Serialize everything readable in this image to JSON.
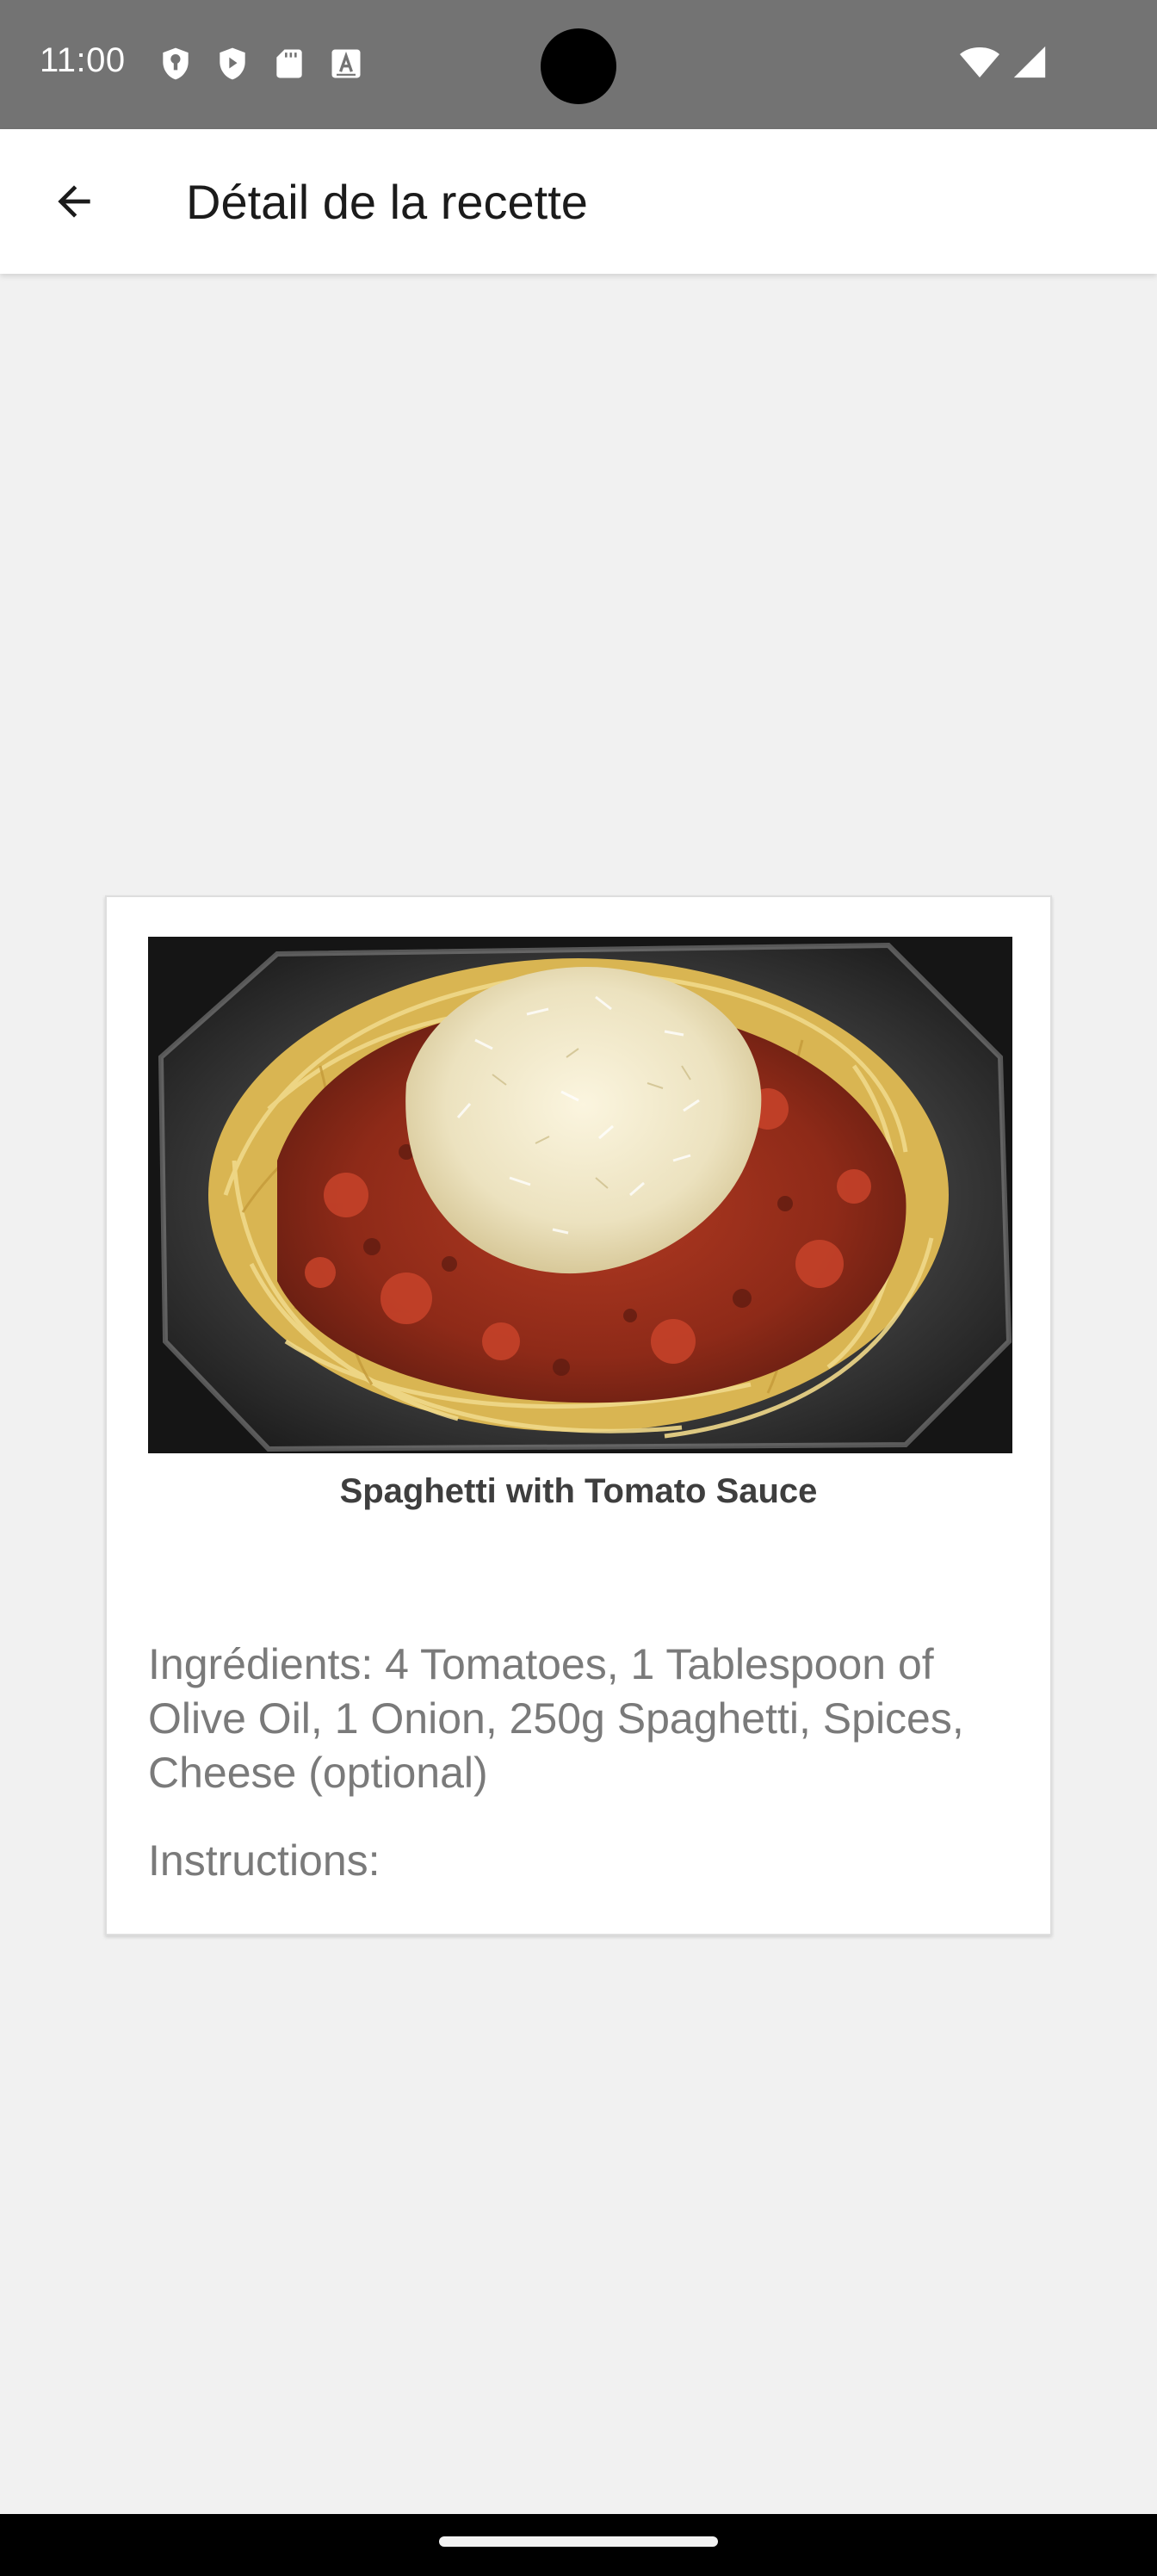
{
  "status_bar": {
    "time": "11:00",
    "left_icons": [
      "vpn-shield-icon",
      "play-protect-icon",
      "sd-card-icon",
      "font-a-icon"
    ],
    "right_icons": [
      "wifi-icon",
      "cell-signal-icon"
    ],
    "background": "#737373"
  },
  "app_bar": {
    "back_icon": "arrow-back-icon",
    "title": "Détail de la recette"
  },
  "recipe": {
    "image_alt": "spaghetti-with-tomato-sauce-photo",
    "name": "Spaghetti with Tomato Sauce",
    "ingredients_label": "Ingrédients: ",
    "ingredients": "4 Tomatoes, 1 Tablespoon of Olive Oil, 1 Onion, 250g Spaghetti, Spices, Cheese (optional)",
    "instructions_label": "Instructions:",
    "instructions": ""
  },
  "colors": {
    "page_background": "#f1f1f1",
    "card_background": "#ffffff",
    "text_secondary": "#7a7a7a",
    "title_text": "#1b1b1b"
  }
}
